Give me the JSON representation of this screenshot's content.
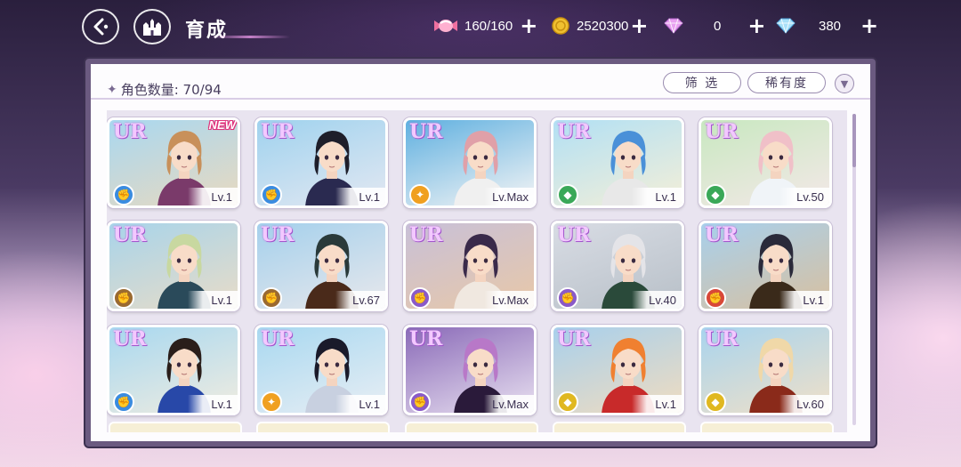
{
  "header": {
    "title": "育成",
    "resources": [
      {
        "icon": "candy-icon",
        "value": "160/160"
      },
      {
        "icon": "coin-icon",
        "value": "2520300"
      },
      {
        "icon": "pink-diamond-icon",
        "value": "0"
      },
      {
        "icon": "blue-diamond-icon",
        "value": "380"
      }
    ],
    "plus": "+"
  },
  "panel": {
    "count_label": "角色数量: 70/94",
    "filter_label": "筛 选",
    "rarity_label": "稀有度",
    "sort_icon": "▼"
  },
  "cards": [
    {
      "rarity": "UR",
      "level": "Lv.1",
      "attr": "blue",
      "new": "NEW",
      "bg": [
        "#a9d8f0",
        "#e8d9c0"
      ],
      "hair": "#c8905a",
      "outfit": "#7a3a6a"
    },
    {
      "rarity": "UR",
      "level": "Lv.1",
      "attr": "blue",
      "new": "",
      "bg": [
        "#9fd2ee",
        "#e3e8f2"
      ],
      "hair": "#1e1e2a",
      "outfit": "#2a2a50"
    },
    {
      "rarity": "UR",
      "level": "Lv.Max",
      "attr": "orange",
      "new": "",
      "bg": [
        "#5fb0e0",
        "#f5f5f5"
      ],
      "hair": "#e0a0a8",
      "outfit": "#f0f0f0"
    },
    {
      "rarity": "UR",
      "level": "Lv.1",
      "attr": "green",
      "new": "",
      "bg": [
        "#b2e0f4",
        "#f4efd8"
      ],
      "hair": "#4a90d8",
      "outfit": "#e8e8e8"
    },
    {
      "rarity": "UR",
      "level": "Lv.50",
      "attr": "green",
      "new": "",
      "bg": [
        "#c8e8c0",
        "#f4e8e8"
      ],
      "hair": "#f0c0c8",
      "outfit": "#f0f4f8"
    },
    {
      "rarity": "UR",
      "level": "Lv.1",
      "attr": "brown",
      "new": "",
      "bg": [
        "#a8d4ea",
        "#e8dcc8"
      ],
      "hair": "#c8d8a0",
      "outfit": "#2a4a5a"
    },
    {
      "rarity": "UR",
      "level": "Lv.67",
      "attr": "brown",
      "new": "",
      "bg": [
        "#a4d0ec",
        "#e8e8ec"
      ],
      "hair": "#2a3a3a",
      "outfit": "#4a2a1a"
    },
    {
      "rarity": "UR",
      "level": "Lv.Max",
      "attr": "purple",
      "new": "",
      "bg": [
        "#c8c0d8",
        "#e8c8a8"
      ],
      "hair": "#3a2a4a",
      "outfit": "#f0e8e0"
    },
    {
      "rarity": "UR",
      "level": "Lv.40",
      "attr": "purple",
      "new": "",
      "bg": [
        "#d8dce4",
        "#b8c0c8"
      ],
      "hair": "#e4e4e8",
      "outfit": "#2a4a3a"
    },
    {
      "rarity": "UR",
      "level": "Lv.1",
      "attr": "red",
      "new": "",
      "bg": [
        "#a8d0ec",
        "#d8c0a0"
      ],
      "hair": "#2a2a3a",
      "outfit": "#3a2a1a"
    },
    {
      "rarity": "UR",
      "level": "Lv.1",
      "attr": "blue",
      "new": "",
      "bg": [
        "#a8d8f0",
        "#f0ece0"
      ],
      "hair": "#2a1e1a",
      "outfit": "#2848a8"
    },
    {
      "rarity": "UR",
      "level": "Lv.1",
      "attr": "orange",
      "new": "",
      "bg": [
        "#a8d8f0",
        "#e8eef4"
      ],
      "hair": "#1a1a2a",
      "outfit": "#c8d0e0"
    },
    {
      "rarity": "UR",
      "level": "Lv.Max",
      "attr": "purple",
      "new": "",
      "bg": [
        "#8a6ab8",
        "#e8e0f0"
      ],
      "hair": "#b878c8",
      "outfit": "#2a1a3a"
    },
    {
      "rarity": "UR",
      "level": "Lv.1",
      "attr": "yellow",
      "new": "",
      "bg": [
        "#a8d0ec",
        "#f0dcc0"
      ],
      "hair": "#f08030",
      "outfit": "#c82a2a"
    },
    {
      "rarity": "UR",
      "level": "Lv.60",
      "attr": "yellow",
      "new": "",
      "bg": [
        "#a8d4ee",
        "#f0e0c8"
      ],
      "hair": "#f0d8a8",
      "outfit": "#8a2a1a"
    }
  ],
  "attr_colors": {
    "blue": "#3a8ce0",
    "orange": "#f0a020",
    "green": "#3aa858",
    "brown": "#9a6a30",
    "purple": "#8a5ac8",
    "red": "#d84838",
    "yellow": "#e0b820"
  }
}
